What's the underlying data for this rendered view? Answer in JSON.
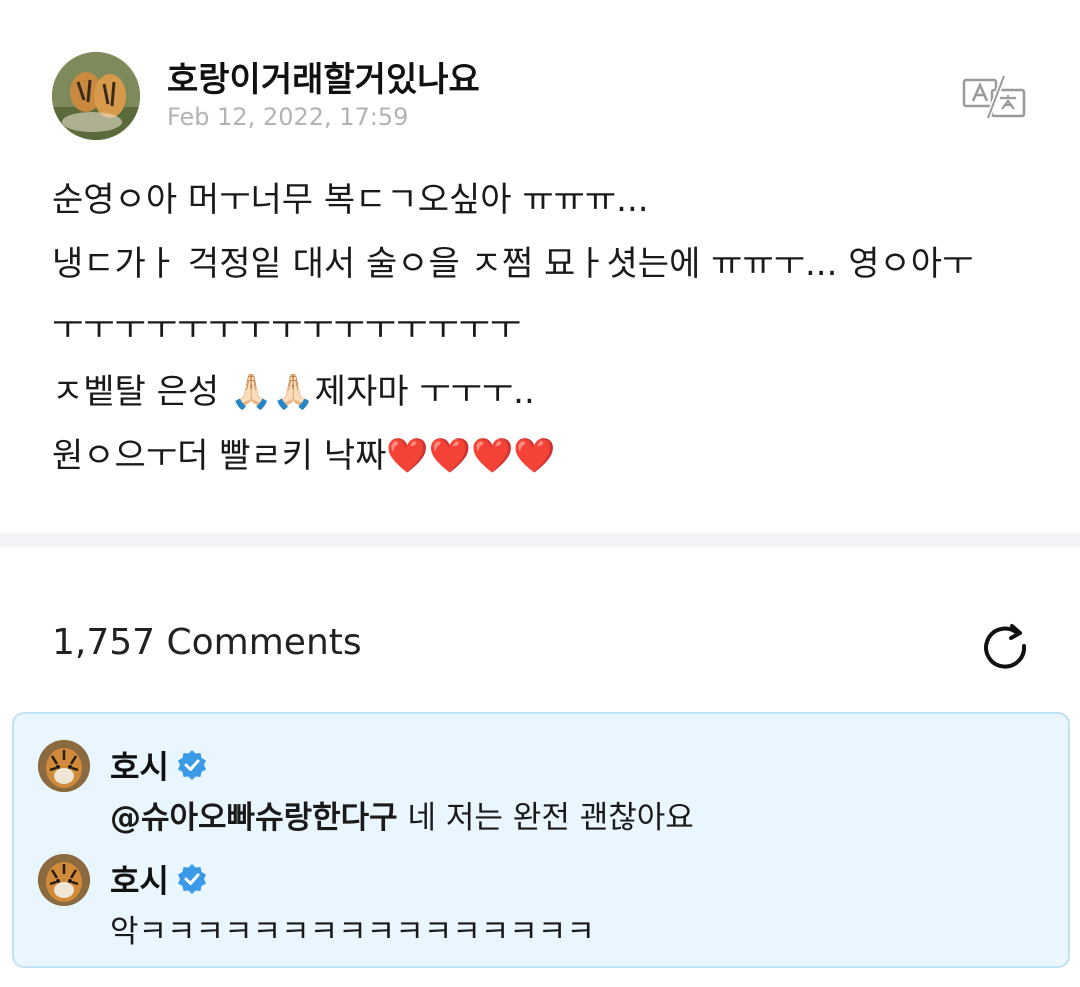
{
  "post": {
    "author": "호랑이거래할거있나요",
    "date": "Feb 12, 2022, 17:59",
    "lines": [
      "순영ㅇ아 머ㅜ너무 복ㄷㄱ오싶아 ㅠㅠㅠ...",
      "냉ㄷ가ㅏ 걱정잍 대서 술ㅇ을 ㅈ쩜 묘ㅏ셧는에 ㅠㅠㅜ... 영ㅇ아ㅜ",
      "ㅜㅜㅜㅜㅜㅜㅜㅜㅜㅜㅜㅜㅜㅜㅜ",
      "ㅈ벹탈 은성 🙏🏻🙏🏻제자마 ㅜㅜㅜ..",
      "원ㅇ으ㅜ더 빨ㄹ키 낙짜❤️❤️❤️❤️"
    ]
  },
  "comments_header": {
    "count_label": "1,757 Comments"
  },
  "replies": [
    {
      "author": "호시",
      "mention": "@슈아오빠슈랑한다구",
      "text": " 네 저는 완전 괜찮아요"
    },
    {
      "author": "호시",
      "mention": "",
      "text": "악ㅋㅋㅋㅋㅋㅋㅋㅋㅋㅋㅋㅋㅋㅋㅋㅋ"
    }
  ],
  "icons": {
    "translate": "translate-icon",
    "refresh": "refresh-icon",
    "verified": "verified-badge-icon"
  },
  "colors": {
    "reply_bg": "#e9f6fd",
    "reply_border": "#bfe1f2",
    "verified": "#3b9ae8"
  }
}
